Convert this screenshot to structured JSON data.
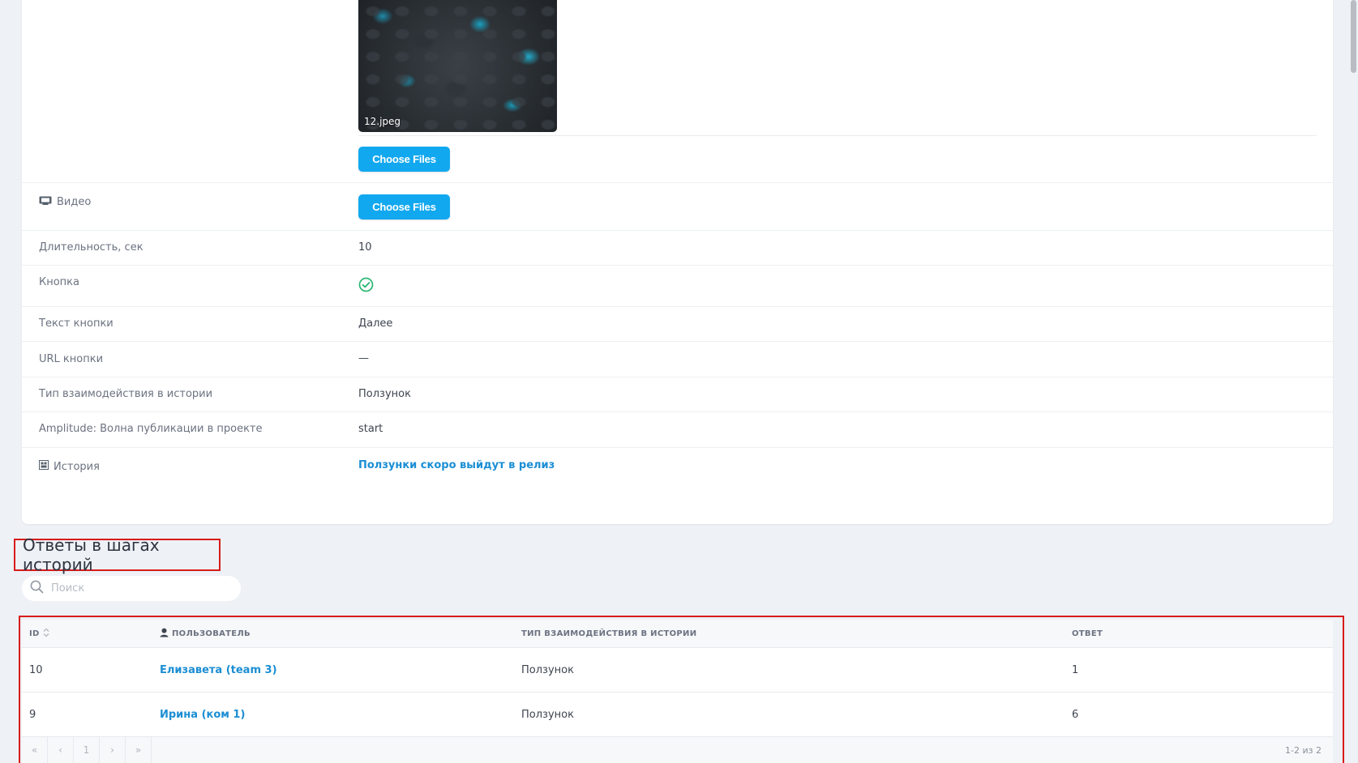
{
  "image_row": {
    "file_name": "12.jpeg",
    "choose_button": "Choose Files"
  },
  "fields": {
    "video": {
      "label": "Видео",
      "button": "Choose Files"
    },
    "duration": {
      "label": "Длительность, сек",
      "value": "10"
    },
    "button": {
      "label": "Кнопка",
      "value_icon": "check-circle-icon"
    },
    "button_text": {
      "label": "Текст кнопки",
      "value": "Далее"
    },
    "button_url": {
      "label": "URL кнопки",
      "value": "—"
    },
    "interaction_type": {
      "label": "Тип взаимодействия в истории",
      "value": "Ползунок"
    },
    "amplitude_wave": {
      "label": "Amplitude: Волна публикации в проекте",
      "value": "start"
    },
    "story": {
      "label": "История",
      "value": "Ползунки скоро выйдут в релиз"
    }
  },
  "answers": {
    "title": "Ответы в шагах историй",
    "search_placeholder": "Поиск",
    "columns": {
      "id": "ID",
      "user": "ПОЛЬЗОВАТЕЛЬ",
      "interaction_type": "ТИП ВЗАИМОДЕЙСТВИЯ В ИСТОРИИ",
      "answer": "ОТВЕТ"
    },
    "rows": [
      {
        "id": "10",
        "user": "Елизавета (team 3)",
        "interaction_type": "Ползунок",
        "answer": "1"
      },
      {
        "id": "9",
        "user": "Ирина (ком 1)",
        "interaction_type": "Ползунок",
        "answer": "6"
      }
    ],
    "pager": {
      "first": "«",
      "prev": "‹",
      "page": "1",
      "next": "›",
      "last": "»",
      "info": "1-2 из 2"
    }
  },
  "colors": {
    "accent": "#12a8ef",
    "link": "#1b8ed4",
    "highlight_border": "#d81b1b",
    "success": "#2bb673",
    "background": "#eef1f5"
  }
}
